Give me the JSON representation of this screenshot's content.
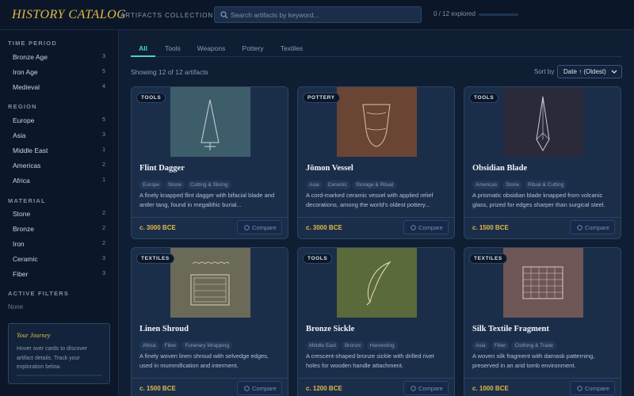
{
  "header": {
    "title": "HISTORY CATALOG",
    "subtitle": "ARTIFACTS COLLECTION",
    "search_placeholder": "Search artifacts by keyword...",
    "progress_text": "0 / 12 explored",
    "progress_fraction": 0
  },
  "sidebar": {
    "time_period": {
      "heading": "TIME PERIOD",
      "items": [
        {
          "label": "Bronze Age",
          "count": "3"
        },
        {
          "label": "Iron Age",
          "count": "5"
        },
        {
          "label": "Medieval",
          "count": "4"
        }
      ]
    },
    "region": {
      "heading": "REGION",
      "items": [
        {
          "label": "Europe",
          "count": "5"
        },
        {
          "label": "Asia",
          "count": "3"
        },
        {
          "label": "Middle East",
          "count": "1"
        },
        {
          "label": "Americas",
          "count": "2"
        },
        {
          "label": "Africa",
          "count": "1"
        }
      ]
    },
    "material": {
      "heading": "MATERIAL",
      "items": [
        {
          "label": "Stone",
          "count": "2"
        },
        {
          "label": "Bronze",
          "count": "2"
        },
        {
          "label": "Iron",
          "count": "2"
        },
        {
          "label": "Ceramic",
          "count": "3"
        },
        {
          "label": "Fiber",
          "count": "3"
        }
      ]
    },
    "active_filters": {
      "heading": "ACTIVE FILTERS",
      "none": "None"
    },
    "journey": {
      "title": "Your Journey",
      "body": "Hover over cards to discover artifact details. Track your exploration below."
    }
  },
  "main": {
    "tabs": [
      {
        "label": "All",
        "active": true
      },
      {
        "label": "Tools",
        "active": false
      },
      {
        "label": "Weapons",
        "active": false
      },
      {
        "label": "Pottery",
        "active": false
      },
      {
        "label": "Textiles",
        "active": false
      }
    ],
    "showing": "Showing 12 of 12 artifacts",
    "sort_label": "Sort by",
    "sort_value": "Date ↑ (Oldest)",
    "compare_label": "Compare"
  },
  "cards": [
    {
      "category": "TOOLS",
      "title": "Flint Dagger",
      "tags": [
        "Europe",
        "Stone",
        "Cutting & Slicing"
      ],
      "desc": "A finely knapped flint dagger with bifacial blade and antler tang, found in megalithic burial...",
      "date": "c. 3000 BCE",
      "bg": "#3e5d6b",
      "icon": "dagger-icon"
    },
    {
      "category": "POTTERY",
      "title": "Jōmon Vessel",
      "tags": [
        "Asia",
        "Ceramic",
        "Storage & Ritual"
      ],
      "desc": "A cord-marked ceramic vessel with applied relief decorations, among the world's oldest pottery...",
      "date": "c. 3000 BCE",
      "bg": "#6a4534",
      "icon": "vessel-icon"
    },
    {
      "category": "TOOLS",
      "title": "Obsidian Blade",
      "tags": [
        "Americas",
        "Stone",
        "Ritual & Cutting"
      ],
      "desc": "A prismatic obsidian blade knapped from volcanic glass, prized for edges sharper than surgical steel.",
      "date": "c. 1500 BCE",
      "bg": "#2a2a3b",
      "icon": "blade-icon"
    },
    {
      "category": "TEXTILES",
      "title": "Linen Shroud",
      "tags": [
        "Africa",
        "Fiber",
        "Funerary Wrapping"
      ],
      "desc": "A finely woven linen shroud with selvedge edges, used in mummification and interment.",
      "date": "c. 1500 BCE",
      "bg": "#6b6a58",
      "icon": "shroud-icon"
    },
    {
      "category": "TOOLS",
      "title": "Bronze Sickle",
      "tags": [
        "Middle East",
        "Bronze",
        "Harvesting"
      ],
      "desc": "A crescent-shaped bronze sickle with drilled rivet holes for wooden handle attachment.",
      "date": "c. 1200 BCE",
      "bg": "#5a6a3a",
      "icon": "sickle-icon"
    },
    {
      "category": "TEXTILES",
      "title": "Silk Textile Fragment",
      "tags": [
        "Asia",
        "Fiber",
        "Clothing & Trade"
      ],
      "desc": "A woven silk fragment with damask patterning, preserved in an arid tomb environment.",
      "date": "c. 1000 BCE",
      "bg": "#6e5656",
      "icon": "textile-icon"
    }
  ],
  "colors": {
    "accent": "#4fd1c5",
    "gold": "#e5b84a",
    "background": "#0f1e33"
  }
}
